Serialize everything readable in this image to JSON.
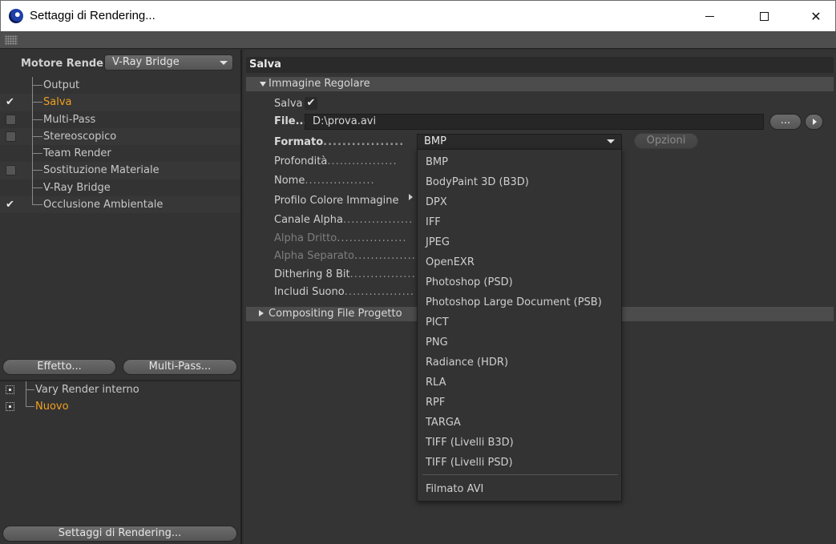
{
  "window": {
    "title": "Settaggi di Rendering..."
  },
  "left": {
    "engine_label": "Motore Render",
    "engine_value": "V-Ray Bridge",
    "tree": [
      {
        "label": "Output",
        "check": "none",
        "active": false
      },
      {
        "label": "Salva",
        "check": "tick",
        "active": true
      },
      {
        "label": "Multi-Pass",
        "check": "box",
        "active": false
      },
      {
        "label": "Stereoscopico",
        "check": "box",
        "active": false
      },
      {
        "label": "Team Render",
        "check": "none",
        "active": false
      },
      {
        "label": "Sostituzione Materiale",
        "check": "box",
        "active": false
      },
      {
        "label": "V-Ray Bridge",
        "check": "none",
        "active": false
      },
      {
        "label": "Occlusione Ambientale",
        "check": "tick",
        "active": false
      }
    ],
    "effetto_button": "Effetto...",
    "multipass_button": "Multi-Pass...",
    "render_settings": [
      {
        "label": "Vary Render interno",
        "active": false
      },
      {
        "label": "Nuovo",
        "active": true
      }
    ],
    "bottom_button": "Settaggi di Rendering..."
  },
  "right": {
    "section_title": "Salva",
    "immagine_header": "Immagine Regolare",
    "salva_label": "Salva",
    "file_label": "File...",
    "file_value": "D:\\prova.avi",
    "file_browse_label": "...",
    "formato_label": "Formato",
    "formato_value": "BMP",
    "opzioni_label": "Opzioni",
    "profondita_label": "Profondità",
    "nome_label": "Nome",
    "profilo_label": "Profilo Colore Immagine",
    "canale_alpha_label": "Canale Alpha",
    "alpha_dritto_label": "Alpha Dritto",
    "alpha_separato_label": "Alpha Separato",
    "dithering_label": "Dithering 8 Bit",
    "includi_suono_label": "Includi Suono",
    "compositing_header": "Compositing File Progetto",
    "dots": ".................",
    "format_options": [
      "BMP",
      "BodyPaint 3D (B3D)",
      "DPX",
      "IFF",
      "JPEG",
      "OpenEXR",
      "Photoshop (PSD)",
      "Photoshop Large Document (PSB)",
      "PICT",
      "PNG",
      "Radiance (HDR)",
      "RLA",
      "RPF",
      "TARGA",
      "TIFF (Livelli B3D)",
      "TIFF (Livelli PSD)"
    ],
    "format_extra_option": "Filmato AVI"
  }
}
